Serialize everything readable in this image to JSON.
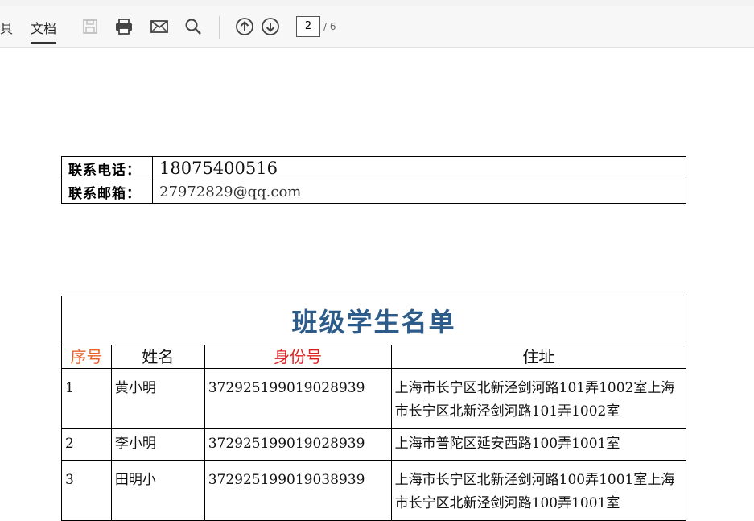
{
  "toolbar": {
    "tab_tools": "具",
    "tab_document": "文档",
    "current_page": "2",
    "total_pages": "/ 6",
    "icons": [
      "save-icon",
      "print-icon",
      "mail-icon",
      "search-icon",
      "arrow-up-icon",
      "arrow-down-icon"
    ]
  },
  "contact": {
    "phone_label": "联系电话：",
    "phone_value": "18075400516",
    "email_label": "联系邮箱：",
    "email_value": "27972829@qq.com"
  },
  "roster": {
    "title": "班级学生名单",
    "headers": [
      "序号",
      "姓名",
      "身份号",
      "住址"
    ],
    "rows": [
      {
        "no": "1",
        "name": "黄小明",
        "id": "372925199019028939",
        "address": "上海市长宁区北新泾剑河路101弄1002室上海市长宁区北新泾剑河路101弄1002室"
      },
      {
        "no": "2",
        "name": "李小明",
        "id": "372925199019028939",
        "address": "上海市普陀区延安西路100弄1001室"
      },
      {
        "no": "3",
        "name": "田明小",
        "id": "372925199019038939",
        "address": "上海市长宁区北新泾剑河路100弄1001室上海市长宁区北新泾剑河路100弄1001室"
      }
    ]
  },
  "colors": {
    "title": "#2e5c8a",
    "header_red": "#e02020",
    "header_orange": "#e8622a"
  }
}
